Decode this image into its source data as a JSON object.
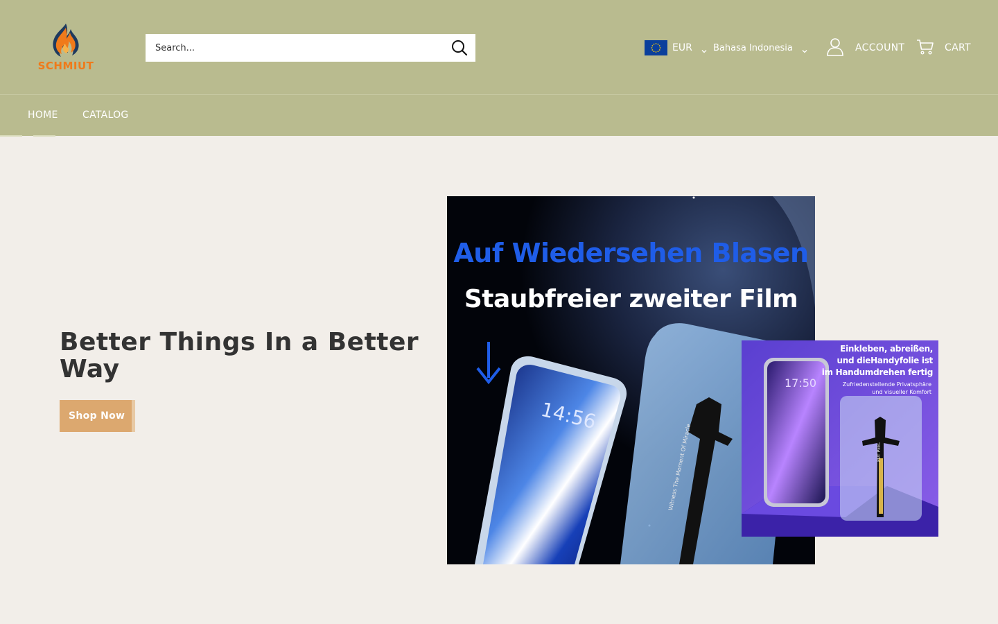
{
  "brand": {
    "name": "SCHMIUT"
  },
  "search": {
    "placeholder": "Search..."
  },
  "currency": {
    "code": "EUR"
  },
  "language": {
    "label": "Bahasa Indonesia"
  },
  "account": {
    "label": "ACCOUNT"
  },
  "cart": {
    "label": "CART"
  },
  "nav": {
    "home": "HOME",
    "catalog": "CATALOG"
  },
  "hero": {
    "title": "Better Things In a Better Way",
    "cta": "Shop Now"
  },
  "main_image": {
    "headline": "Auf Wiedersehen Blasen",
    "subheadline": "Staubfreier zweiter Film",
    "phone_time": "14:56",
    "tool_text": "Witness The Moment Of Miracle"
  },
  "inset_image": {
    "line1": "Einkleben, abreißen,",
    "line2": "und dieHandyfolie ist",
    "line3": "im Handumdrehen fertig",
    "small1": "Zufriedenstellende Privatsphäre",
    "small2": "und visueller Komfort",
    "phone_time": "17:50",
    "tool_text": "PUT PEEL"
  },
  "colors": {
    "header_bg": "#b9bb8f",
    "page_bg": "#f2eee9",
    "accent": "#dca86f",
    "logo_orange": "#f07a1a"
  },
  "icons": {
    "search": "search-icon",
    "account": "user-icon",
    "cart": "cart-icon",
    "flag": "eu-flag-icon",
    "chevron": "chevron-down-icon"
  }
}
